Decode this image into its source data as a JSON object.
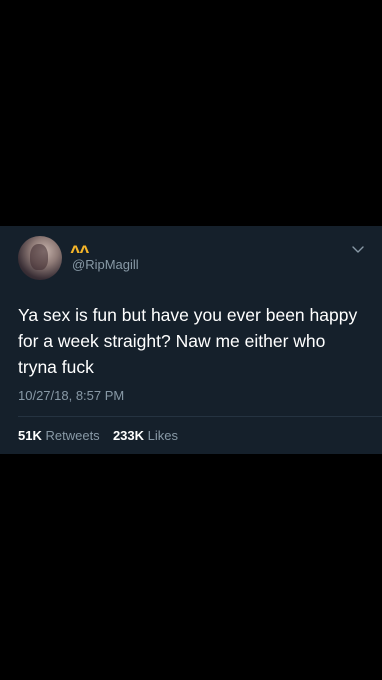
{
  "user": {
    "name_glyph": "ʌʌ",
    "handle": "@RipMagill"
  },
  "tweet": {
    "text": "Ya sex is fun but have you ever been happy for a week straight? Naw me either who tryna fuck",
    "timestamp": "10/27/18, 8:57 PM"
  },
  "stats": {
    "retweets_count": "51K",
    "retweets_label": "Retweets",
    "likes_count": "233K",
    "likes_label": "Likes"
  },
  "icons": {
    "menu": "chevron-down-icon"
  },
  "colors": {
    "card_background": "#15202b",
    "secondary_text": "#8899a6",
    "name_mark": "#f5b529"
  }
}
